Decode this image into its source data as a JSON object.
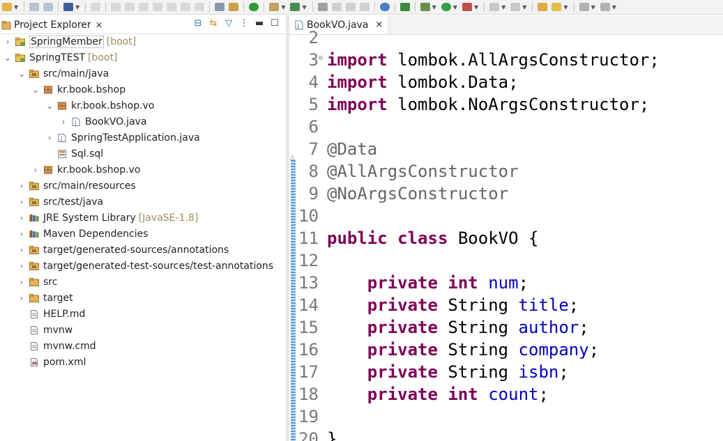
{
  "explorer": {
    "tab_title": "Project Explorer",
    "close_glyph": "×",
    "actions": [
      "collapse-all-icon",
      "link-editor-icon",
      "filter-icon",
      "view-menu-icon",
      "minimize-icon",
      "maximize-icon"
    ],
    "items": [
      {
        "label": "SpringMember",
        "decoration": "[boot]",
        "icon": "boot-project-icon",
        "twisty": "›"
      },
      {
        "label": "SpringTEST",
        "decoration": "[boot]",
        "icon": "boot-project-icon",
        "twisty": "⌄"
      },
      {
        "label": "src/main/java",
        "icon": "source-folder-icon",
        "twisty": "⌄"
      },
      {
        "label": "kr.book.bshop",
        "icon": "package-icon",
        "twisty": "⌄"
      },
      {
        "label": "kr.book.bshop.vo",
        "icon": "package-icon",
        "twisty": "⌄"
      },
      {
        "label": "BookVO.java",
        "icon": "java-file-icon",
        "twisty": "›"
      },
      {
        "label": "SpringTestApplication.java",
        "icon": "java-file-icon",
        "twisty": "›"
      },
      {
        "label": "Sql.sql",
        "icon": "sql-file-icon",
        "twisty": ""
      },
      {
        "label": "kr.book.bshop.vo",
        "icon": "package-icon",
        "twisty": "›"
      },
      {
        "label": "src/main/resources",
        "icon": "source-folder-icon",
        "twisty": "›"
      },
      {
        "label": "src/test/java",
        "icon": "source-folder-icon",
        "twisty": "›"
      },
      {
        "label": "JRE System Library",
        "decoration": "[JavaSE-1.8]",
        "icon": "library-icon",
        "twisty": "›"
      },
      {
        "label": "Maven Dependencies",
        "icon": "library-icon",
        "twisty": "›"
      },
      {
        "label": "target/generated-sources/annotations",
        "icon": "source-folder-icon",
        "twisty": "›"
      },
      {
        "label": "target/generated-test-sources/test-annotations",
        "icon": "source-folder-icon",
        "twisty": "›"
      },
      {
        "label": "src",
        "icon": "folder-icon",
        "twisty": "›"
      },
      {
        "label": "target",
        "icon": "folder-icon",
        "twisty": "›"
      },
      {
        "label": "HELP.md",
        "icon": "text-file-icon",
        "twisty": ""
      },
      {
        "label": "mvnw",
        "icon": "text-file-icon",
        "twisty": ""
      },
      {
        "label": "mvnw.cmd",
        "icon": "text-file-icon",
        "twisty": ""
      },
      {
        "label": "pom.xml",
        "icon": "maven-file-icon",
        "twisty": ""
      }
    ]
  },
  "editor": {
    "tab_title": "BookVO.java",
    "close_glyph": "×",
    "lines": [
      {
        "num": "2",
        "text": ""
      },
      {
        "num": "3",
        "fold": "⊖",
        "text": "import lombok.AllArgsConstructor;"
      },
      {
        "num": "4",
        "text": "import lombok.Data;"
      },
      {
        "num": "5",
        "text": "import lombok.NoArgsConstructor;"
      },
      {
        "num": "6",
        "text": ""
      },
      {
        "num": "7",
        "text": "@Data"
      },
      {
        "num": "8",
        "text": "@AllArgsConstructor"
      },
      {
        "num": "9",
        "text": "@NoArgsConstructor"
      },
      {
        "num": "10",
        "text": ""
      },
      {
        "num": "11",
        "text": "public class BookVO {"
      },
      {
        "num": "12",
        "text": ""
      },
      {
        "num": "13",
        "text": "    private int num;"
      },
      {
        "num": "14",
        "text": "    private String title;"
      },
      {
        "num": "15",
        "text": "    private String author;"
      },
      {
        "num": "16",
        "text": "    private String company;"
      },
      {
        "num": "17",
        "text": "    private String isbn;"
      },
      {
        "num": "18",
        "text": "    private int count;"
      },
      {
        "num": "19",
        "text": ""
      },
      {
        "num": "20",
        "text": "}"
      }
    ]
  },
  "colors": {
    "keyword": "#7f0055",
    "annotation": "#646464",
    "field": "#0000c0",
    "line_number": "#787878",
    "decoration": "#a08d5a"
  }
}
